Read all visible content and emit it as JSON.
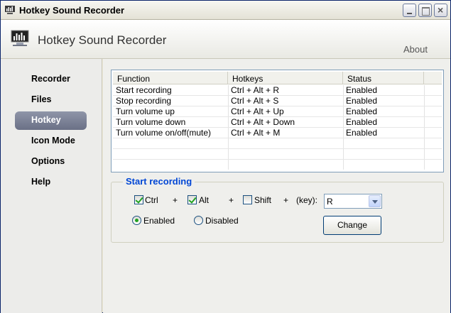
{
  "window": {
    "title": "Hotkey Sound Recorder"
  },
  "header": {
    "app_name": "Hotkey Sound Recorder",
    "about_label": "About"
  },
  "sidebar": {
    "items": [
      {
        "label": "Recorder",
        "active": false
      },
      {
        "label": "Files",
        "active": false
      },
      {
        "label": "Hotkey",
        "active": true
      },
      {
        "label": "Icon Mode",
        "active": false
      },
      {
        "label": "Options",
        "active": false
      },
      {
        "label": "Help",
        "active": false
      }
    ]
  },
  "hotkey_table": {
    "columns": [
      "Function",
      "Hotkeys",
      "Status"
    ],
    "rows": [
      {
        "function": "Start recording",
        "hotkeys": "Ctrl + Alt + R",
        "status": "Enabled"
      },
      {
        "function": "Stop recording",
        "hotkeys": "Ctrl + Alt + S",
        "status": "Enabled"
      },
      {
        "function": "Turn volume up",
        "hotkeys": "Ctrl + Alt + Up",
        "status": "Enabled"
      },
      {
        "function": "Turn volume down",
        "hotkeys": "Ctrl + Alt + Down",
        "status": "Enabled"
      },
      {
        "function": "Turn volume on/off(mute)",
        "hotkeys": "Ctrl + Alt + M",
        "status": "Enabled"
      }
    ]
  },
  "editor": {
    "group_title": "Start recording",
    "ctrl": {
      "label": "Ctrl",
      "checked": true
    },
    "alt": {
      "label": "Alt",
      "checked": true
    },
    "shift": {
      "label": "Shift",
      "checked": false
    },
    "plus": "+",
    "key_label": "(key):",
    "key_value": "R",
    "enabled_label": "Enabled",
    "disabled_label": "Disabled",
    "enabled_selected": true,
    "change_label": "Change"
  },
  "colors": {
    "group_title": "#0046d5",
    "active_nav": "#7a8096",
    "check_mark": "#21a121"
  },
  "icons": {
    "app": "recorder-icon",
    "logo": "equalizer-monitor-icon"
  }
}
